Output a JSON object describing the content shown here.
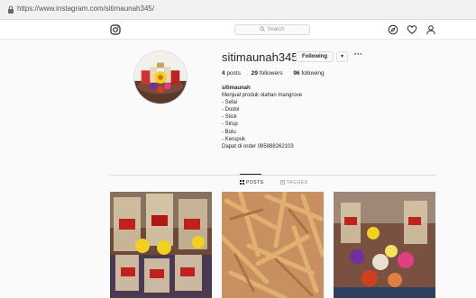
{
  "browser": {
    "url": "https://www.instagram.com/sitimaunah345/"
  },
  "nav": {
    "search_placeholder": "Search",
    "icons": [
      "instagram-logo-icon",
      "compass-icon",
      "heart-icon",
      "user-icon"
    ]
  },
  "profile": {
    "username": "sitimaunah345",
    "follow_label": "Following",
    "dropdown_label": "▾",
    "more_label": "···",
    "stats": {
      "posts_count": "4",
      "posts_label": "posts",
      "followers_count": "29",
      "followers_label": "followers",
      "following_count": "96",
      "following_label": "following"
    },
    "bio": {
      "name": "sitimaunah",
      "lines": [
        "Menjual produk olahan mangrove",
        "- Selai",
        "- Dodol",
        "- Stick",
        "- Sirup",
        "- Bolu",
        "- Kerupuk",
        "Dapat di order 085888262103"
      ]
    }
  },
  "tabs": {
    "posts_label": "POSTS",
    "tagged_label": "TAGGED",
    "active": "posts"
  },
  "colors": {
    "text": "#262626",
    "muted": "#8e8e8e",
    "border": "#dbdbdb",
    "background": "#fafafa"
  }
}
